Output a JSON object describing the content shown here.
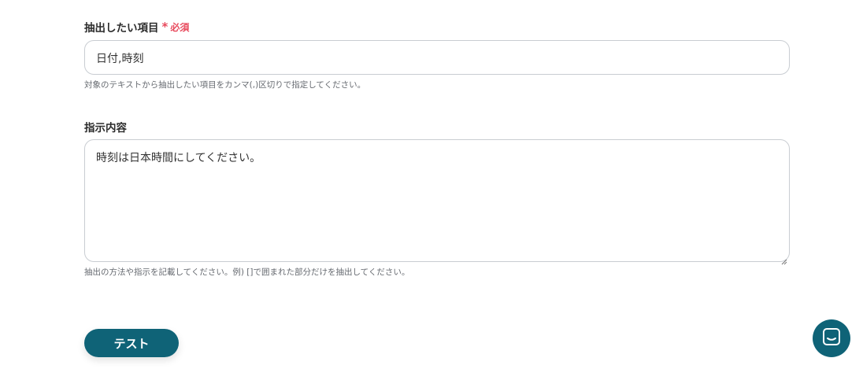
{
  "extract_field": {
    "label": "抽出したい項目",
    "required_mark": "*",
    "required_text": "必須",
    "value": "日付,時刻",
    "help": "対象のテキストから抽出したい項目をカンマ(,)区切りで指定してください。"
  },
  "instruction_field": {
    "label": "指示内容",
    "value": "時刻は日本時間にしてください。",
    "help": "抽出の方法や指示を記載してください。例) []で囲まれた部分だけを抽出してください。"
  },
  "actions": {
    "test_label": "テスト"
  },
  "icons": {
    "chat": "chat-icon",
    "resize": "resize-handle-icon"
  },
  "colors": {
    "accent": "#0f6377",
    "required": "#e8495c"
  }
}
